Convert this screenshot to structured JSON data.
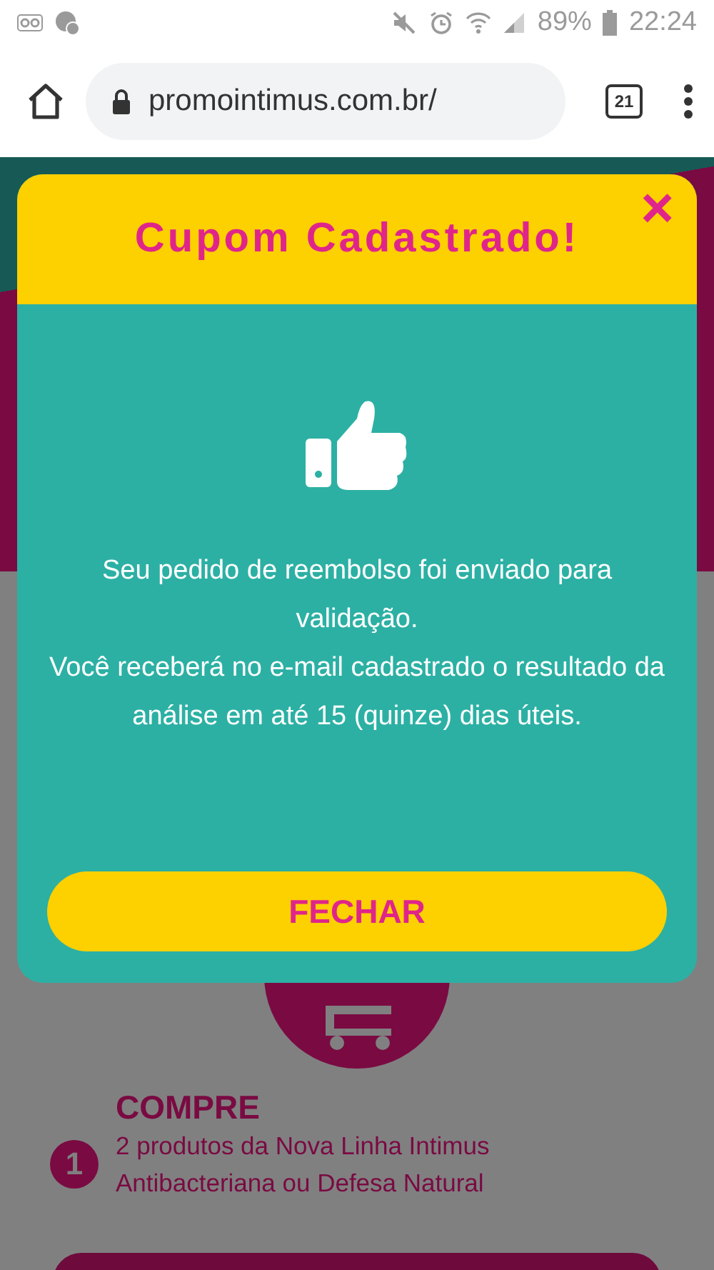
{
  "status_bar": {
    "battery": "89%",
    "time": "22:24"
  },
  "browser": {
    "url": "promointimus.com.br/",
    "tab_count": "21"
  },
  "page": {
    "step": {
      "number": "1",
      "title": "COMPRE",
      "text": "2 produtos da Nova Linha Intimus Antibacteriana ou Defesa Natural"
    }
  },
  "modal": {
    "title": "Cupom Cadastrado!",
    "close": "×",
    "paragraphs": [
      "Seu pedido de reembolso foi enviado para validação.",
      "Você receberá no e-mail cadastrado o resultado da análise em até 15 (quinze) dias úteis."
    ],
    "button": "FECHAR"
  }
}
